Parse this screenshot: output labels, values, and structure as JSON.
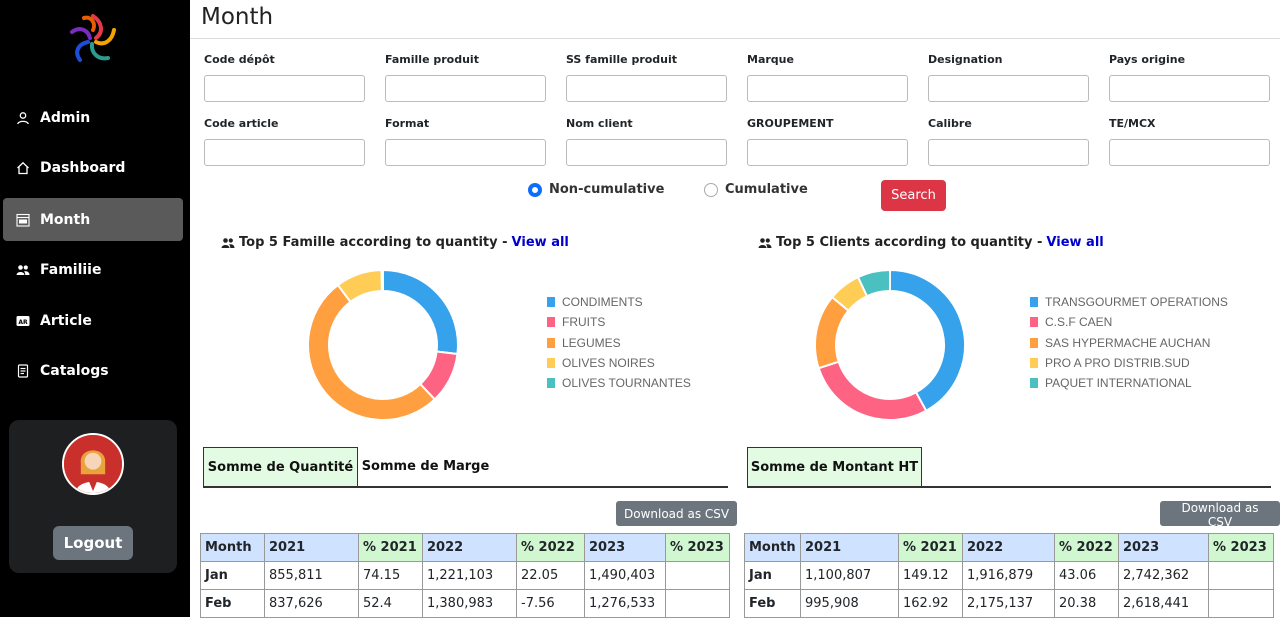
{
  "sidebar": {
    "nav": [
      {
        "label": "Admin",
        "icon": "user-icon"
      },
      {
        "label": "Dashboard",
        "icon": "home-icon"
      },
      {
        "label": "Month",
        "icon": "calendar-icon"
      },
      {
        "label": "Familiie",
        "icon": "users-icon"
      },
      {
        "label": "Article",
        "icon": "ar-badge-icon"
      },
      {
        "label": "Catalogs",
        "icon": "document-icon"
      }
    ],
    "active_index": 2,
    "logout_label": "Logout"
  },
  "page": {
    "title": "Month"
  },
  "filters": {
    "fields": [
      {
        "label": "Code dépôt",
        "value": ""
      },
      {
        "label": "Famille produit",
        "value": ""
      },
      {
        "label": "SS famille produit",
        "value": ""
      },
      {
        "label": "Marque",
        "value": ""
      },
      {
        "label": "Designation",
        "value": ""
      },
      {
        "label": "Pays origine",
        "value": ""
      },
      {
        "label": "Code article",
        "value": ""
      },
      {
        "label": "Format",
        "value": ""
      },
      {
        "label": "Nom client",
        "value": ""
      },
      {
        "label": "GROUPEMENT",
        "value": ""
      },
      {
        "label": "Calibre",
        "value": ""
      },
      {
        "label": "TE/MCX",
        "value": ""
      }
    ],
    "radio_noncumulative": "Non-cumulative",
    "radio_cumulative": "Cumulative",
    "selected": "Non-cumulative",
    "search_label": "Search"
  },
  "left_panel": {
    "title": "Top 5 Famille according to quantity - ",
    "link": "View all",
    "tabs": [
      "Somme de Quantité",
      "Somme de Marge"
    ],
    "csv_label": "Download as CSV",
    "table": {
      "headers": [
        "Month",
        "2021",
        "% 2021",
        "2022",
        "% 2022",
        "2023",
        "% 2023"
      ],
      "rows": [
        [
          "Jan",
          "855,811",
          "74.15",
          "1,221,103",
          "22.05",
          "1,490,403",
          ""
        ],
        [
          "Feb",
          "837,626",
          "52.4",
          "1,380,983",
          "-7.56",
          "1,276,533",
          ""
        ]
      ]
    }
  },
  "right_panel": {
    "title": "Top 5 Clients according to quantity - ",
    "link": "View all",
    "tabs": [
      "Somme de Montant HT"
    ],
    "csv_label": "Download as CSV",
    "table": {
      "headers": [
        "Month",
        "2021",
        "% 2021",
        "2022",
        "% 2022",
        "2023",
        "% 2023"
      ],
      "rows": [
        [
          "Jan",
          "1,100,807",
          "149.12",
          "1,916,879",
          "43.06",
          "2,742,362",
          ""
        ],
        [
          "Feb",
          "995,908",
          "162.92",
          "2,175,137",
          "20.38",
          "2,618,441",
          ""
        ]
      ]
    }
  },
  "chart_data": [
    {
      "type": "pie",
      "categories": [
        "CONDIMENTS",
        "FRUITS",
        "LEGUMES",
        "OLIVES NOIRES",
        "OLIVES TOURNANTES"
      ],
      "values": [
        27,
        11,
        52,
        10,
        0.3
      ],
      "colors": [
        "#36a2eb",
        "#ff6384",
        "#ff9f40",
        "#ffcd56",
        "#4bc0c0"
      ],
      "legend": "right"
    },
    {
      "type": "pie",
      "categories": [
        "TRANSGOURMET OPERATIONS",
        "C.S.F CAEN",
        "SAS HYPERMACHE AUCHAN",
        "PRO A PRO DISTRIB.SUD",
        "PAQUET INTERNATIONAL"
      ],
      "values": [
        42,
        28,
        16,
        7,
        7
      ],
      "colors": [
        "#36a2eb",
        "#ff6384",
        "#ff9f40",
        "#ffcd56",
        "#4bc0c0"
      ],
      "legend": "right"
    }
  ]
}
